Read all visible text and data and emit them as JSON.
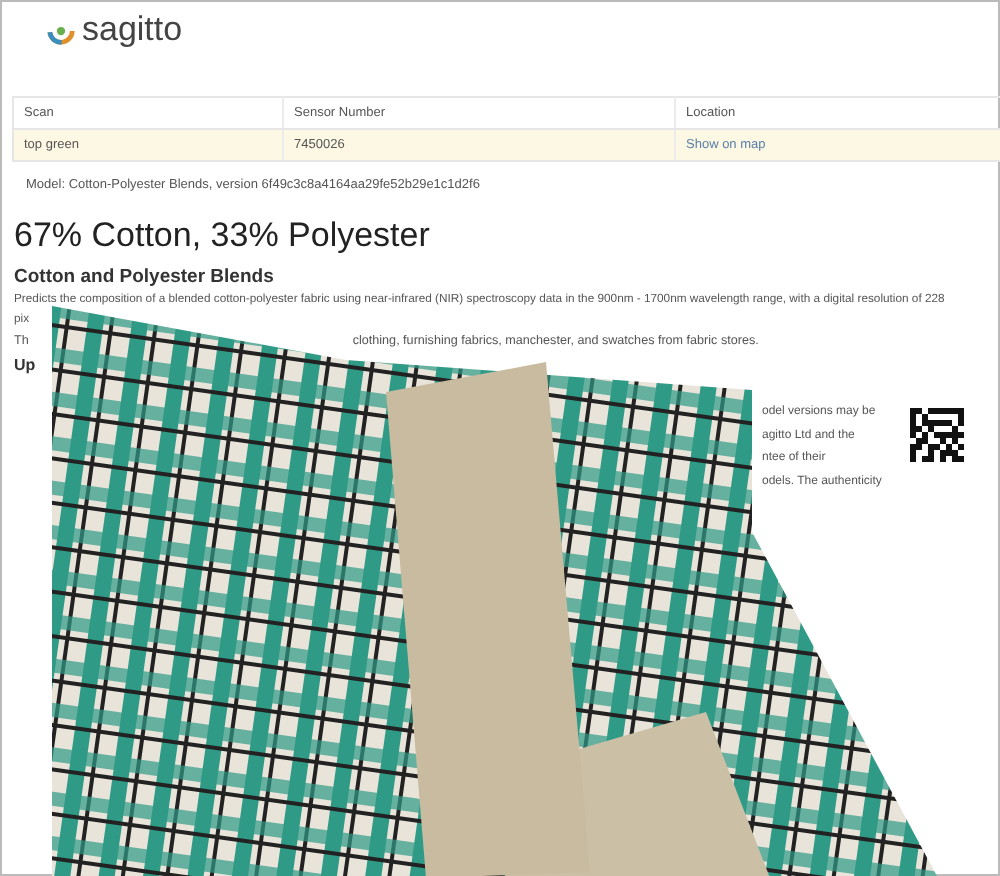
{
  "logo": {
    "text": "sagitto"
  },
  "table": {
    "columns": [
      {
        "label": "Scan",
        "kind": "text"
      },
      {
        "label": "Sensor Number",
        "kind": "text"
      },
      {
        "label": "Location",
        "kind": "link"
      }
    ],
    "rows": [
      {
        "cells": [
          "top green",
          "7450026",
          "Show on map"
        ]
      }
    ]
  },
  "model_line": "Model: Cotton-Polyester Blends, version 6f49c3c8a4164aa29fe52b29e1c1d2f6",
  "result": "67% Cotton, 33% Polyester",
  "model_title": "Cotton and Polyester Blends",
  "description": [
    "Predicts the composition of a blended cotton-polyester fabric using near-infrared (NIR) spectroscopy data in the 900nm - 1700nm wavelength range, with a digital resolution of 228",
    "pix"
  ],
  "description_2": {
    "start": "Th",
    "end": "clothing, furnishing fabrics, manchester, and swatches from fabric stores."
  },
  "section_heading": "Up",
  "side_note": [
    "odel versions may be",
    "agitto Ltd and the",
    "ntee of their",
    "odels. The authenticity"
  ]
}
